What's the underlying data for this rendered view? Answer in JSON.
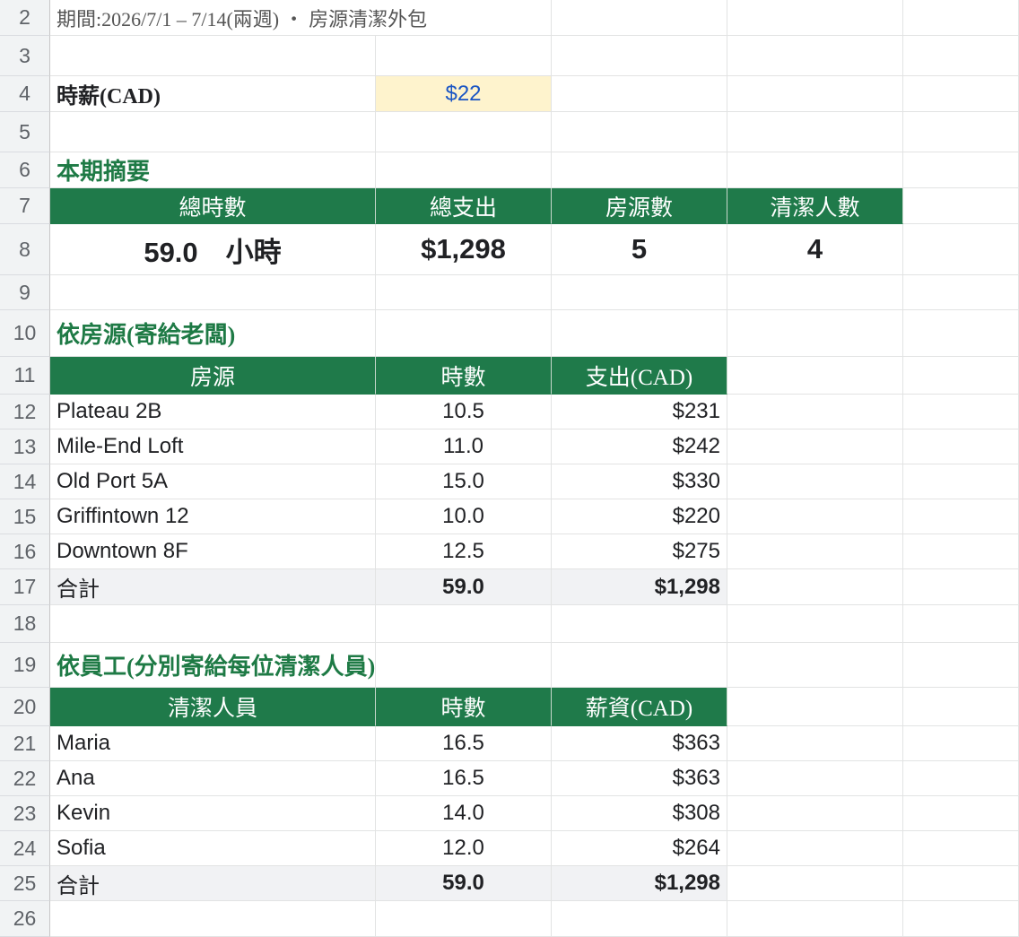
{
  "rows": [
    "2",
    "3",
    "4",
    "5",
    "6",
    "7",
    "8",
    "9",
    "10",
    "11",
    "12",
    "13",
    "14",
    "15",
    "16",
    "17",
    "18",
    "19",
    "20",
    "21",
    "22",
    "23",
    "24",
    "25",
    "26"
  ],
  "period_line": "期間:2026/7/1 – 7/14(兩週) ・ 房源清潔外包",
  "rate": {
    "label": "時薪(CAD)",
    "value": "$22"
  },
  "summary": {
    "title": "本期摘要",
    "headers": [
      "總時數",
      "總支出",
      "房源數",
      "清潔人數"
    ],
    "values": [
      "59.0　小時",
      "$1,298",
      "5",
      "4"
    ]
  },
  "by_property": {
    "title": "依房源(寄給老闆)",
    "headers": [
      "房源",
      "時數",
      "支出(CAD)"
    ],
    "rows": [
      [
        "Plateau 2B",
        "10.5",
        "$231"
      ],
      [
        "Mile-End Loft",
        "11.0",
        "$242"
      ],
      [
        "Old Port 5A",
        "15.0",
        "$330"
      ],
      [
        "Griffintown 12",
        "10.0",
        "$220"
      ],
      [
        "Downtown 8F",
        "12.5",
        "$275"
      ]
    ],
    "total": [
      "合計",
      "59.0",
      "$1,298"
    ]
  },
  "by_staff": {
    "title": "依員工(分別寄給每位清潔人員)",
    "headers": [
      "清潔人員",
      "時數",
      "薪資(CAD)"
    ],
    "rows": [
      [
        "Maria",
        "16.5",
        "$363"
      ],
      [
        "Ana",
        "16.5",
        "$363"
      ],
      [
        "Kevin",
        "14.0",
        "$308"
      ],
      [
        "Sofia",
        "12.0",
        "$264"
      ]
    ],
    "total": [
      "合計",
      "59.0",
      "$1,298"
    ]
  }
}
